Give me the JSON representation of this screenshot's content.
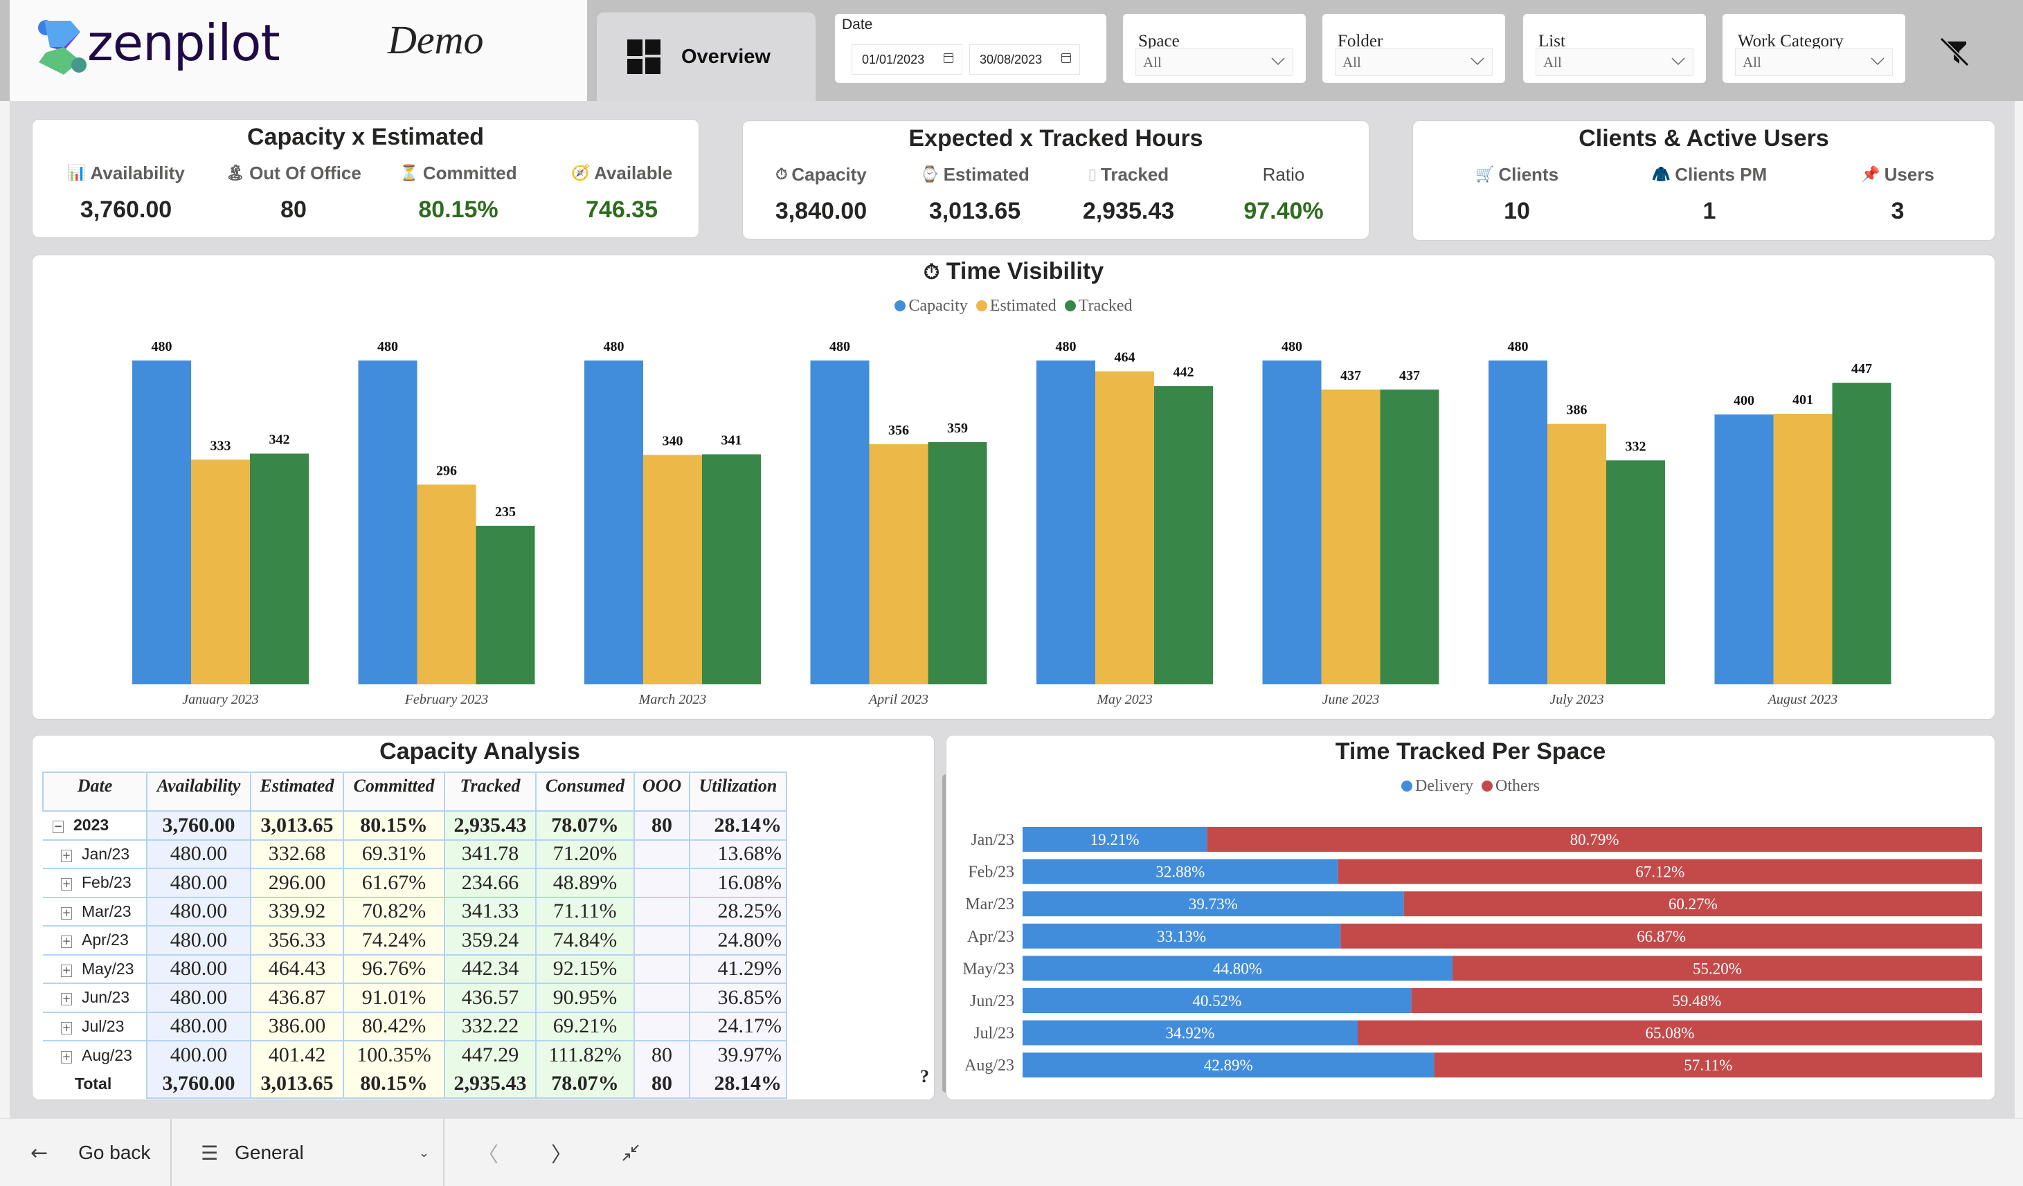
{
  "header": {
    "logo_text": "zenpilot",
    "title": "Demo",
    "active_tab": {
      "label": "Overview",
      "icon": "dashboard-icon"
    },
    "filters": {
      "date": {
        "label": "Date",
        "start": "01/01/2023",
        "end": "30/08/2023"
      },
      "space": {
        "label": "Space",
        "value": "All"
      },
      "folder": {
        "label": "Folder",
        "value": "All"
      },
      "list": {
        "label": "List",
        "value": "All"
      },
      "work_category": {
        "label": "Work Category",
        "value": "All"
      }
    },
    "clear_filters_icon": "filter-clear-icon"
  },
  "colors": {
    "capacity": "#428ddb",
    "estimated": "#ecb847",
    "tracked": "#388749",
    "delivery": "#428ddb",
    "others": "#c44a4a",
    "positive": "#2e6b1f"
  },
  "cards": {
    "capacity_estimated": {
      "title": "Capacity x Estimated",
      "kpis": [
        {
          "icon": "bar-chart-icon",
          "label": "Availability",
          "value": "3,760.00",
          "highlight": false
        },
        {
          "icon": "palm-tree-icon",
          "label": "Out Of Office",
          "value": "80",
          "highlight": false
        },
        {
          "icon": "hourglass-icon",
          "label": "Committed",
          "value": "80.15%",
          "highlight": true
        },
        {
          "icon": "compass-icon",
          "label": "Available",
          "value": "746.35",
          "highlight": true
        }
      ]
    },
    "expected_tracked": {
      "title": "Expected x Tracked Hours",
      "kpis": [
        {
          "icon": "stopwatch-icon",
          "label": "Capacity",
          "value": "3,840.00",
          "highlight": false
        },
        {
          "icon": "watch-icon",
          "label": "Estimated",
          "value": "3,013.65",
          "highlight": false
        },
        {
          "icon": "tracked-icon",
          "label": "Tracked",
          "value": "2,935.43",
          "highlight": false
        },
        {
          "icon": "",
          "label": "Ratio",
          "value": "97.40%",
          "highlight": true
        }
      ]
    },
    "clients_users": {
      "title": "Clients & Active Users",
      "kpis": [
        {
          "icon": "cart-icon",
          "label": "Clients",
          "value": "10",
          "highlight": false
        },
        {
          "icon": "person-icon",
          "label": "Clients PM",
          "value": "1",
          "highlight": false
        },
        {
          "icon": "pushpin-icon",
          "label": "Users",
          "value": "3",
          "highlight": false
        }
      ]
    }
  },
  "chart_data": [
    {
      "type": "bar",
      "title": "Time Visibility",
      "title_icon": "stopwatch-icon",
      "categories": [
        "January 2023",
        "February 2023",
        "March 2023",
        "April 2023",
        "May 2023",
        "June 2023",
        "July 2023",
        "August 2023"
      ],
      "series": [
        {
          "name": "Capacity",
          "values": [
            480,
            480,
            480,
            480,
            480,
            480,
            480,
            400
          ]
        },
        {
          "name": "Estimated",
          "values": [
            333,
            296,
            340,
            356,
            464,
            437,
            386,
            401
          ]
        },
        {
          "name": "Tracked",
          "values": [
            342,
            235,
            341,
            359,
            442,
            437,
            332,
            447
          ]
        }
      ],
      "legend": "top-center",
      "ylim": [
        0,
        480
      ],
      "grid": false,
      "data_labels": true
    },
    {
      "type": "bar",
      "orientation": "horizontal",
      "stacked": "100%",
      "title": "Time Tracked Per Space",
      "categories": [
        "Jan/23",
        "Feb/23",
        "Mar/23",
        "Apr/23",
        "May/23",
        "Jun/23",
        "Jul/23",
        "Aug/23"
      ],
      "series": [
        {
          "name": "Delivery",
          "values": [
            19.21,
            32.88,
            39.73,
            33.13,
            44.8,
            40.52,
            34.92,
            42.89
          ],
          "labels": [
            "19.21%",
            "32.88%",
            "39.73%",
            "33.13%",
            "44.80%",
            "40.52%",
            "34.92%",
            "42.89%"
          ]
        },
        {
          "name": "Others",
          "values": [
            80.79,
            67.12,
            60.27,
            66.87,
            55.2,
            59.48,
            65.08,
            57.11
          ],
          "labels": [
            "80.79%",
            "67.12%",
            "60.27%",
            "66.87%",
            "55.20%",
            "59.48%",
            "65.08%",
            "57.11%"
          ]
        }
      ],
      "legend": "top-center",
      "xlim": [
        0,
        100
      ]
    }
  ],
  "capacity_analysis": {
    "title": "Capacity Analysis",
    "columns": [
      "Date",
      "Availability",
      "Estimated",
      "Committed",
      "Tracked",
      "Consumed",
      "OOO",
      "Utilization"
    ],
    "year_row": {
      "label": "2023",
      "expand_icon": "collapse-icon",
      "cells": [
        "3,760.00",
        "3,013.65",
        "80.15%",
        "2,935.43",
        "78.07%",
        "80",
        "28.14%"
      ]
    },
    "rows": [
      {
        "label": "Jan/23",
        "cells": [
          "480.00",
          "332.68",
          "69.31%",
          "341.78",
          "71.20%",
          "",
          "13.68%"
        ]
      },
      {
        "label": "Feb/23",
        "cells": [
          "480.00",
          "296.00",
          "61.67%",
          "234.66",
          "48.89%",
          "",
          "16.08%"
        ]
      },
      {
        "label": "Mar/23",
        "cells": [
          "480.00",
          "339.92",
          "70.82%",
          "341.33",
          "71.11%",
          "",
          "28.25%"
        ]
      },
      {
        "label": "Apr/23",
        "cells": [
          "480.00",
          "356.33",
          "74.24%",
          "359.24",
          "74.84%",
          "",
          "24.80%"
        ]
      },
      {
        "label": "May/23",
        "cells": [
          "480.00",
          "464.43",
          "96.76%",
          "442.34",
          "92.15%",
          "",
          "41.29%"
        ]
      },
      {
        "label": "Jun/23",
        "cells": [
          "480.00",
          "436.87",
          "91.01%",
          "436.57",
          "90.95%",
          "",
          "36.85%"
        ]
      },
      {
        "label": "Jul/23",
        "cells": [
          "480.00",
          "386.00",
          "80.42%",
          "332.22",
          "69.21%",
          "",
          "24.17%"
        ]
      },
      {
        "label": "Aug/23",
        "cells": [
          "400.00",
          "401.42",
          "100.35%",
          "447.29",
          "111.82%",
          "80",
          "39.97%"
        ]
      }
    ],
    "total_row": {
      "label": "Total",
      "cells": [
        "3,760.00",
        "3,013.65",
        "80.15%",
        "2,935.43",
        "78.07%",
        "80",
        "28.14%"
      ]
    },
    "help_marker": "?"
  },
  "footer": {
    "go_back": "Go back",
    "page_select": "General",
    "prev_icon": "chevron-left-icon",
    "next_icon": "chevron-right-icon",
    "fit_icon": "collapse-arrows-icon"
  }
}
